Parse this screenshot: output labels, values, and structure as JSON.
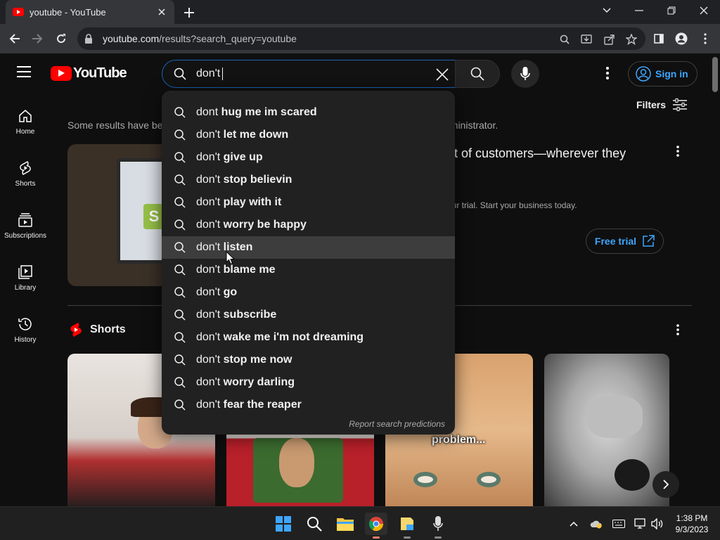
{
  "browser": {
    "tab_title": "youtube - YouTube",
    "url_host": "youtube.com",
    "url_path": "/results?search_query=youtube"
  },
  "header": {
    "logo_text": "YouTube",
    "search_value": "don't",
    "sign_in": "Sign in"
  },
  "sidebar": {
    "items": [
      {
        "label": "Home",
        "icon": "home-icon"
      },
      {
        "label": "Shorts",
        "icon": "shorts-icon"
      },
      {
        "label": "Subscriptions",
        "icon": "subscriptions-icon"
      },
      {
        "label": "Library",
        "icon": "library-icon"
      },
      {
        "label": "History",
        "icon": "history-icon"
      }
    ]
  },
  "main": {
    "filters_label": "Filters",
    "notice_left": "Some results have be",
    "notice_right": "dministrator.",
    "ad_title": "ront of customers—wherever they",
    "ad_desc": "g your trial. Start your business today.",
    "ad_cta": "Free trial",
    "shorts_label": "Shorts",
    "short_caption": "problem..."
  },
  "suggestions": {
    "items": [
      {
        "prefix": "dont",
        "rest": " hug me im scared"
      },
      {
        "prefix": "don't",
        "rest": " let me down"
      },
      {
        "prefix": "don't",
        "rest": " give up"
      },
      {
        "prefix": "don't",
        "rest": " stop believin"
      },
      {
        "prefix": "don't",
        "rest": " play with it"
      },
      {
        "prefix": "don't",
        "rest": " worry be happy"
      },
      {
        "prefix": "don't",
        "rest": " listen"
      },
      {
        "prefix": "don't",
        "rest": " blame me"
      },
      {
        "prefix": "don't",
        "rest": " go"
      },
      {
        "prefix": "don't",
        "rest": " subscribe"
      },
      {
        "prefix": "don't",
        "rest": " wake me i'm not dreaming"
      },
      {
        "prefix": "don't",
        "rest": " stop me now"
      },
      {
        "prefix": "don't",
        "rest": " worry darling"
      },
      {
        "prefix": "don't",
        "rest": " fear the reaper"
      }
    ],
    "hovered_index": 6,
    "report": "Report search predictions"
  },
  "taskbar": {
    "time": "1:38 PM",
    "date": "9/3/2023"
  },
  "colors": {
    "accent_blue": "#3ea6ff",
    "brand_red": "#ff0000",
    "search_border": "#1c62b9"
  }
}
